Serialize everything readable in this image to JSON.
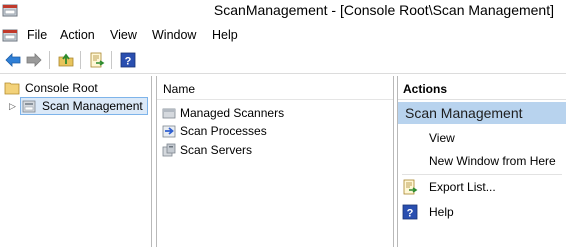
{
  "window": {
    "title": "ScanManagement - [Console Root\\Scan Management]",
    "app_icon": "mmc-console-icon"
  },
  "menubar": {
    "doc_icon": "console-document-icon",
    "items": [
      {
        "label": "File"
      },
      {
        "label": "Action"
      },
      {
        "label": "View"
      },
      {
        "label": "Window"
      },
      {
        "label": "Help"
      }
    ]
  },
  "toolbar": {
    "buttons": [
      {
        "icon": "back-arrow-icon"
      },
      {
        "icon": "forward-arrow-icon"
      },
      {
        "icon": "up-one-level-icon"
      },
      {
        "icon": "export-list-icon"
      },
      {
        "icon": "help-icon"
      }
    ]
  },
  "tree": {
    "root": {
      "label": "Console Root",
      "icon": "folder-icon"
    },
    "child": {
      "label": "Scan Management",
      "icon": "scan-management-icon",
      "selected": true,
      "expander": "▷"
    }
  },
  "middle": {
    "column_header": "Name",
    "items": [
      {
        "label": "Managed Scanners",
        "icon": "scanner-icon"
      },
      {
        "label": "Scan Processes",
        "icon": "scan-process-icon"
      },
      {
        "label": "Scan Servers",
        "icon": "scan-server-icon"
      }
    ]
  },
  "actions": {
    "header": "Actions",
    "group_title": "Scan Management",
    "items": [
      {
        "label": "View",
        "icon": ""
      },
      {
        "label": "New Window from Here",
        "icon": ""
      },
      {
        "label": "Export List...",
        "icon": "export-list-icon"
      },
      {
        "label": "Help",
        "icon": "help-icon"
      }
    ]
  },
  "colors": {
    "selection_bg": "#dbe9f8",
    "selection_border": "#7eb4ea",
    "actions_group_bg": "#b8d3ee",
    "help_blue": "#2a4fb0",
    "arrow_blue": "#2f7fd6"
  }
}
